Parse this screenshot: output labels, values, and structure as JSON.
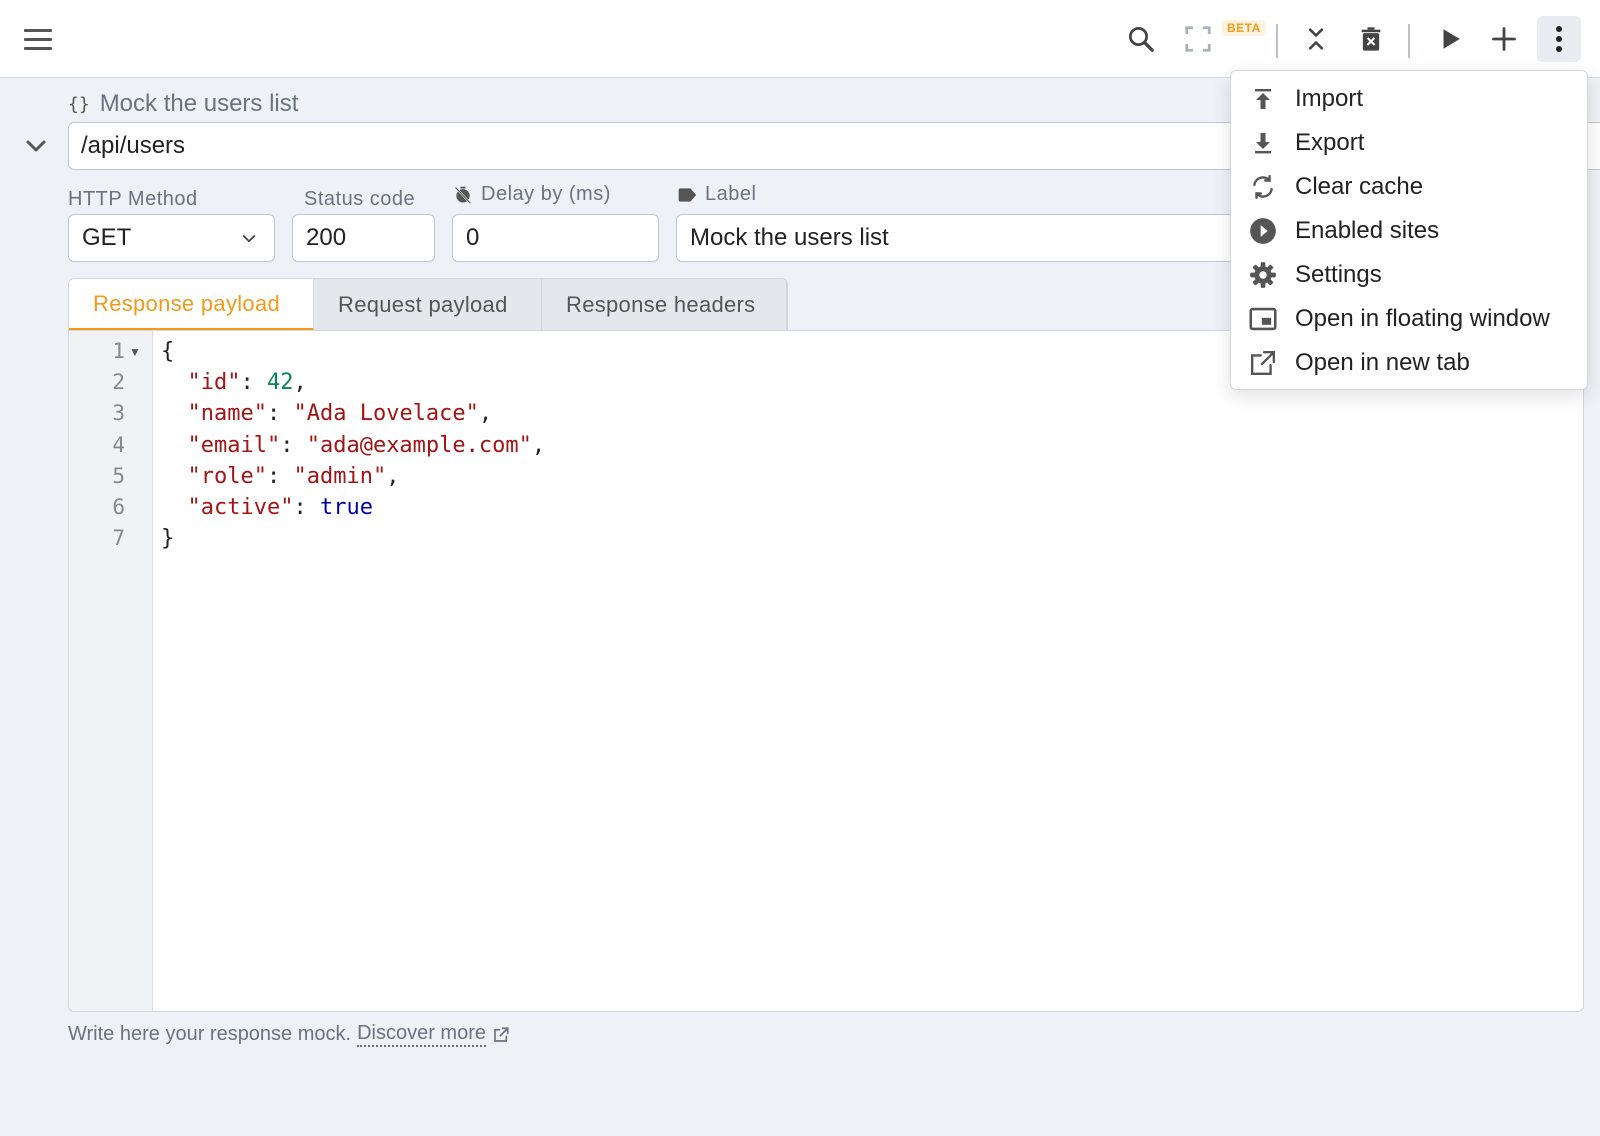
{
  "toolbar": {
    "icons": [
      "menu-icon",
      "search-icon",
      "fullscreen-icon",
      "collapse-all-icon",
      "delete-all-icon",
      "play-icon",
      "add-icon",
      "more-vert-icon"
    ],
    "beta_badge": "BETA"
  },
  "route": {
    "title": "Mock the users list",
    "url": "/api/users"
  },
  "fields": {
    "method_label": "HTTP Method",
    "method_value": "GET",
    "status_label": "Status code",
    "status_value": "200",
    "delay_label": "Delay by (ms)",
    "delay_value": "0",
    "label_label": "Label",
    "label_value": "Mock the users list"
  },
  "tabs": [
    {
      "label": "Response payload",
      "active": true
    },
    {
      "label": "Request payload",
      "active": false
    },
    {
      "label": "Response headers",
      "active": false
    }
  ],
  "editor": {
    "line_numbers": [
      "1",
      "2",
      "3",
      "4",
      "5",
      "6",
      "7"
    ],
    "lines": [
      {
        "parts": [
          [
            "p",
            "{"
          ]
        ]
      },
      {
        "parts": [
          [
            "p",
            "  "
          ],
          [
            "k",
            "\"id\""
          ],
          [
            "p",
            ": "
          ],
          [
            "n",
            "42"
          ],
          [
            "p",
            ","
          ]
        ]
      },
      {
        "parts": [
          [
            "p",
            "  "
          ],
          [
            "k",
            "\"name\""
          ],
          [
            "p",
            ": "
          ],
          [
            "s",
            "\"Ada Lovelace\""
          ],
          [
            "p",
            ","
          ]
        ]
      },
      {
        "parts": [
          [
            "p",
            "  "
          ],
          [
            "k",
            "\"email\""
          ],
          [
            "p",
            ": "
          ],
          [
            "s",
            "\"ada@example.com\""
          ],
          [
            "p",
            ","
          ]
        ]
      },
      {
        "parts": [
          [
            "p",
            "  "
          ],
          [
            "k",
            "\"role\""
          ],
          [
            "p",
            ": "
          ],
          [
            "s",
            "\"admin\""
          ],
          [
            "p",
            ","
          ]
        ]
      },
      {
        "parts": [
          [
            "p",
            "  "
          ],
          [
            "k",
            "\"active\""
          ],
          [
            "p",
            ": "
          ],
          [
            "b",
            "true"
          ]
        ]
      },
      {
        "parts": [
          [
            "p",
            "}"
          ]
        ]
      }
    ]
  },
  "hint": {
    "text": "Write here your response mock.",
    "link": "Discover more"
  },
  "menu": {
    "items": [
      {
        "label": "Import",
        "icon": "upload-icon"
      },
      {
        "label": "Export",
        "icon": "download-icon"
      },
      {
        "label": "Clear cache",
        "icon": "refresh-icon"
      },
      {
        "label": "Enabled sites",
        "icon": "play-circle-icon"
      },
      {
        "label": "Settings",
        "icon": "gear-icon"
      },
      {
        "label": "Open in floating window",
        "icon": "picture-in-picture-icon"
      },
      {
        "label": "Open in new tab",
        "icon": "open-external-icon"
      }
    ]
  },
  "colors": {
    "accent": "#f39a1a",
    "background": "#eef1f5",
    "string": "#a31515",
    "number": "#098658",
    "boolean": "#0000a0"
  }
}
